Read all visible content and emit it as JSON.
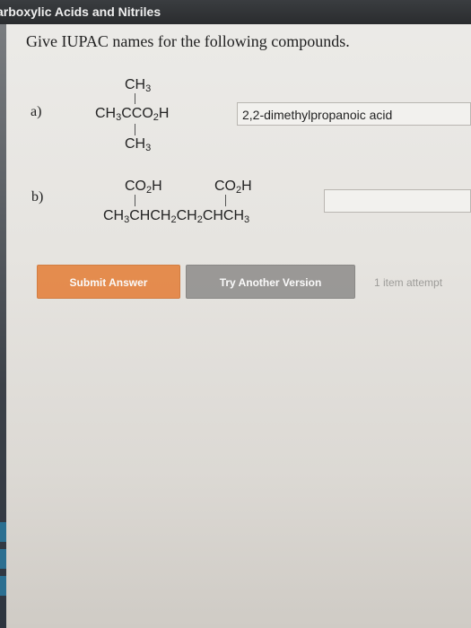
{
  "header": {
    "title": "arboxylic Acids and Nitriles"
  },
  "instructions": "Give IUPAC names for the following compounds.",
  "questions": [
    {
      "label": "a)",
      "structure": {
        "top": "CH3",
        "main": "CH3CCO2H",
        "bottom": "CH3"
      },
      "answer": "2,2-dimethylpropanoic acid"
    },
    {
      "label": "b)",
      "structure": {
        "sub1": "CO2H",
        "sub2": "CO2H",
        "main": "CH3CHCH2CH2CHCH3"
      },
      "answer": ""
    }
  ],
  "buttons": {
    "submit": "Submit Answer",
    "try_another": "Try Another Version"
  },
  "attempt_note": "1 item attempt"
}
